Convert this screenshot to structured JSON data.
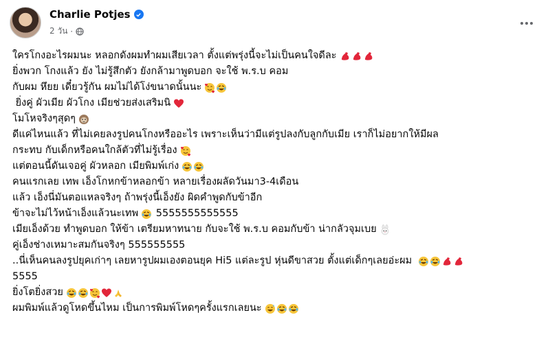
{
  "post": {
    "author": "Charlie Potjes",
    "time": "2 วัน",
    "privacy_icon": "globe-icon",
    "lines": [
      {
        "text": "ใครโกงอะไรผมนะ หลอกดังผมทำผมเสียเวลา ตั้งแต่พรุ่งนี้จะไม่เป็นคนใจดีละ",
        "emojis": [
          "flexed-biceps",
          "flexed-biceps",
          "flexed-biceps"
        ]
      },
      {
        "text": "ยิ่งพวก โกงแล้ว ยัง ไม่รู้สึกตัว ยังกล้ามาพูดบอก จะใช้ พ.ร.บ คอม",
        "emojis": []
      },
      {
        "text": "กับผม หึยย เดี๋ยวรู้กัน ผมไม่ได้โง่ขนาดนั้นนะ",
        "emojis": [
          "smiling-hearts",
          "rolling-laughing"
        ]
      },
      {
        "text": " ยิ่งคู่ ผัวเมีย ผัวโกง เมียช่วยส่งเสริมนิ",
        "emojis": [
          "red-heart"
        ]
      },
      {
        "text": "โมโหจริงๆสุดๆ",
        "emojis": [
          "sloth"
        ]
      },
      {
        "text": "ดีแค่ไหนแล้ว ที่ไม่เคยลงรูปคนโกงหรืออะไร เพราะเห็นว่ามีแต่รูปลงกับลูกกับเมีย เราก็ไม่อยากให้มีผล",
        "emojis": []
      },
      {
        "text": "กระทบ กับเด็กหรือคนใกล้ตัวที่ไม่รู้เรื่อง",
        "emojis": [
          "smiling-hearts"
        ]
      },
      {
        "text": "แต่ตอนนี้ดันเจอคู่ ผัวหลอก เมียพิมพ์เก่ง",
        "emojis": [
          "rolling-laughing",
          "rolling-laughing"
        ]
      },
      {
        "text": "คนแรกเลย เทพ เอ็งโกหกข้าหลอกข้า หลายเรื่องผลัดวันมา3-4เดือน",
        "emojis": []
      },
      {
        "text": "แล้ว เอ็งนี่มันตอแหลจริงๆ ถ้าพรุ่งนี้เอ็งยัง ผิดคำพูดกับข้าอีก",
        "emojis": []
      },
      {
        "text": "ข้าจะไม่ไว้หน้าเอ็งแล้วนะเทพ",
        "emojis": [
          "rolling-laughing"
        ],
        "after": " 5555555555555"
      },
      {
        "text": "เมียเอ็งด้วย ทำพูดบอก ให้ข้า เตรียมหาทนาย กับจะใช้ พ.ร.บ คอมกับข้า น่ากลัวจุมเบย",
        "emojis": [
          "rabbit"
        ]
      },
      {
        "text": "คู่เอ็งช่างเหมาะสมกันจริงๆ 555555555",
        "emojis": []
      },
      {
        "text": "..นี่เห็นคนลงรูปยุคเก่าๆ เลยหารูปผมเองตอนยุค Hi5 แต่ละรูป หุ่นดีขาสวย ตั้งแต่เด็กๆเลยอ่ะผม ",
        "emojis": [
          "rolling-laughing",
          "rolling-laughing",
          "flexed-biceps",
          "flexed-biceps"
        ]
      },
      {
        "text": "5555",
        "emojis": []
      },
      {
        "text": "ยิ่งโตยิ่งสวย",
        "emojis": [
          "rolling-laughing",
          "rolling-laughing",
          "smiling-hearts",
          "red-heart",
          "folded-hands"
        ]
      },
      {
        "text": "ผมพิมพ์แล้วดูโหดขึ้นไหม เป็นการพิมพ์โหดๆครั้งแรกเลยนะ",
        "emojis": [
          "grinning-sweat",
          "rolling-laughing",
          "rolling-laughing"
        ]
      }
    ]
  },
  "colors": {
    "verified": "#1877f2",
    "meta_text": "#65676b"
  }
}
